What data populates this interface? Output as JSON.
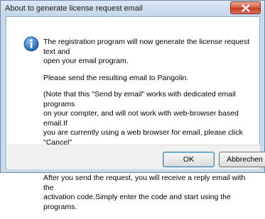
{
  "window": {
    "title": "About to generate license request email"
  },
  "message": {
    "p1": "The registration program will now generate the license request text and\nopen your email program.",
    "p2": "Please send the resulting email to Pangolin.",
    "p3": "(Note that this \"Send by email\" works with dedicated email programs\non your compter, and will not work with web-browser based email.If\nyou are currently using a web browser for email, please click \"Cancel\"\nbelow, and then choose the button to \"Generate a text file instead\".)",
    "p4": "After you send the request, you will receive a reply email with the\nactivation code.Simply enter the code and start using the programs."
  },
  "buttons": {
    "ok": "OK",
    "cancel": "Abbrechen"
  },
  "colors": {
    "info_icon": "#2f6fbd",
    "close_button": "#c43b24"
  }
}
